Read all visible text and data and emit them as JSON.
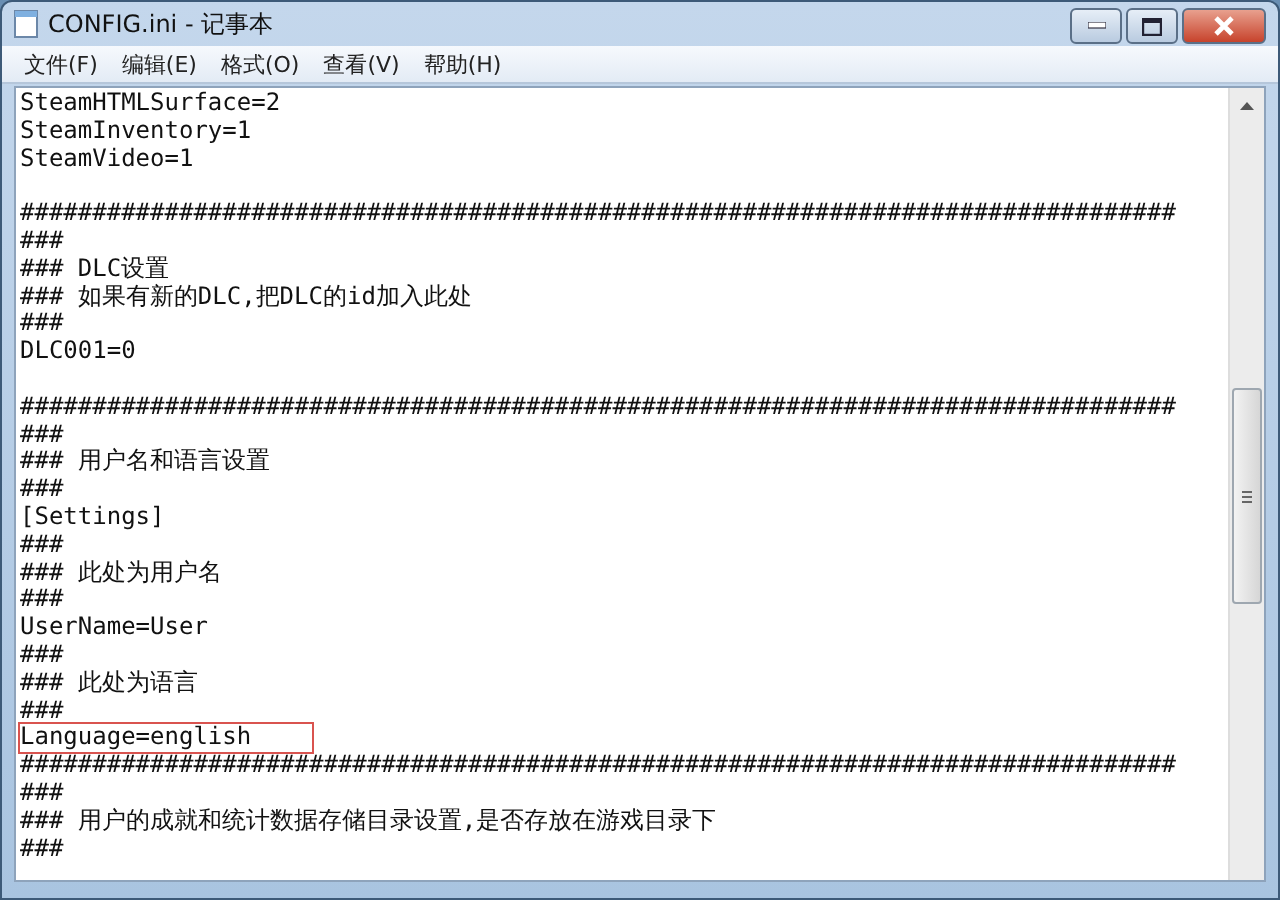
{
  "window": {
    "title": "CONFIG.ini - 记事本"
  },
  "menu": [
    "文件(F)",
    "编辑(E)",
    "格式(O)",
    "查看(V)",
    "帮助(H)"
  ],
  "editor": {
    "lines": [
      {
        "kind": "text",
        "text": "SteamHTMLSurface=2",
        "highlighted": false
      },
      {
        "kind": "text",
        "text": "SteamInventory=1",
        "highlighted": false
      },
      {
        "kind": "text",
        "text": "SteamVideo=1",
        "highlighted": false
      },
      {
        "kind": "blank"
      },
      {
        "kind": "text",
        "text": "################################################################################",
        "highlighted": false
      },
      {
        "kind": "text",
        "text": "###",
        "highlighted": false
      },
      {
        "kind": "text",
        "text": "### DLC设置",
        "highlighted": false
      },
      {
        "kind": "text",
        "text": "### 如果有新的DLC,把DLC的id加入此处",
        "highlighted": false
      },
      {
        "kind": "text",
        "text": "###",
        "highlighted": false
      },
      {
        "kind": "text",
        "text": "DLC001=0",
        "highlighted": false
      },
      {
        "kind": "blank"
      },
      {
        "kind": "text",
        "text": "################################################################################",
        "highlighted": false
      },
      {
        "kind": "text",
        "text": "###",
        "highlighted": false
      },
      {
        "kind": "text",
        "text": "### 用户名和语言设置",
        "highlighted": false
      },
      {
        "kind": "text",
        "text": "###",
        "highlighted": false
      },
      {
        "kind": "text",
        "text": "[Settings]",
        "highlighted": false
      },
      {
        "kind": "text",
        "text": "###",
        "highlighted": false
      },
      {
        "kind": "text",
        "text": "### 此处为用户名",
        "highlighted": false
      },
      {
        "kind": "text",
        "text": "###",
        "highlighted": false
      },
      {
        "kind": "text",
        "text": "UserName=User",
        "highlighted": false
      },
      {
        "kind": "text",
        "text": "###",
        "highlighted": false
      },
      {
        "kind": "text",
        "text": "### 此处为语言",
        "highlighted": false
      },
      {
        "kind": "text",
        "text": "###",
        "highlighted": false
      },
      {
        "kind": "text",
        "text": "Language=english",
        "highlighted": true
      },
      {
        "kind": "text",
        "text": "################################################################################",
        "highlighted": false
      },
      {
        "kind": "text",
        "text": "###",
        "highlighted": false
      },
      {
        "kind": "text",
        "text": "### 用户的成就和统计数据存储目录设置,是否存放在游戏目录下",
        "highlighted": false
      },
      {
        "kind": "text",
        "text": "###",
        "highlighted": false
      }
    ]
  }
}
